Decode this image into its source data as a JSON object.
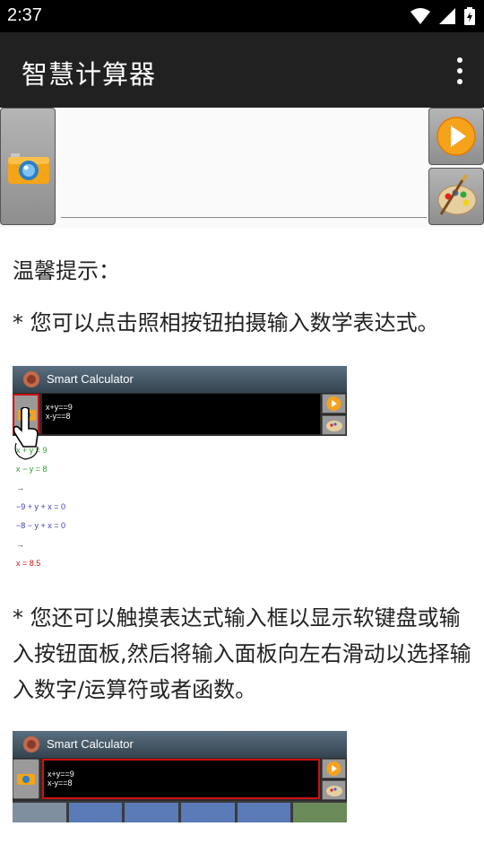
{
  "status": {
    "time": "2:37"
  },
  "app": {
    "title": "智慧计算器"
  },
  "input": {
    "value": "",
    "placeholder": ""
  },
  "tips": {
    "title": "温馨提示：",
    "p1": "* 您可以点击照相按钮拍摄输入数学表达式。",
    "p2": "* 您还可以触摸表达式输入框以显示软键盘或输入按钮面板,然后将输入面板向左右滑动以选择输入数字/运算符或者函数。"
  },
  "screenshot1": {
    "title": "Smart Calculator",
    "expr_line1": "x+y==9",
    "expr_line2": "x-y==8",
    "lines": [
      "x + y = 9",
      "x − y = 8",
      "→",
      "−9 + y + x = 0",
      "−8 − y + x = 0",
      "→",
      "x  =  8.5"
    ]
  },
  "screenshot2": {
    "title": "Smart Calculator",
    "expr_line1": "x+y==9",
    "expr_line2": "x-y==8"
  },
  "colors": {
    "accent_red": "#d01010",
    "green": "#2e9b2e",
    "blue": "#3a3ab8"
  }
}
